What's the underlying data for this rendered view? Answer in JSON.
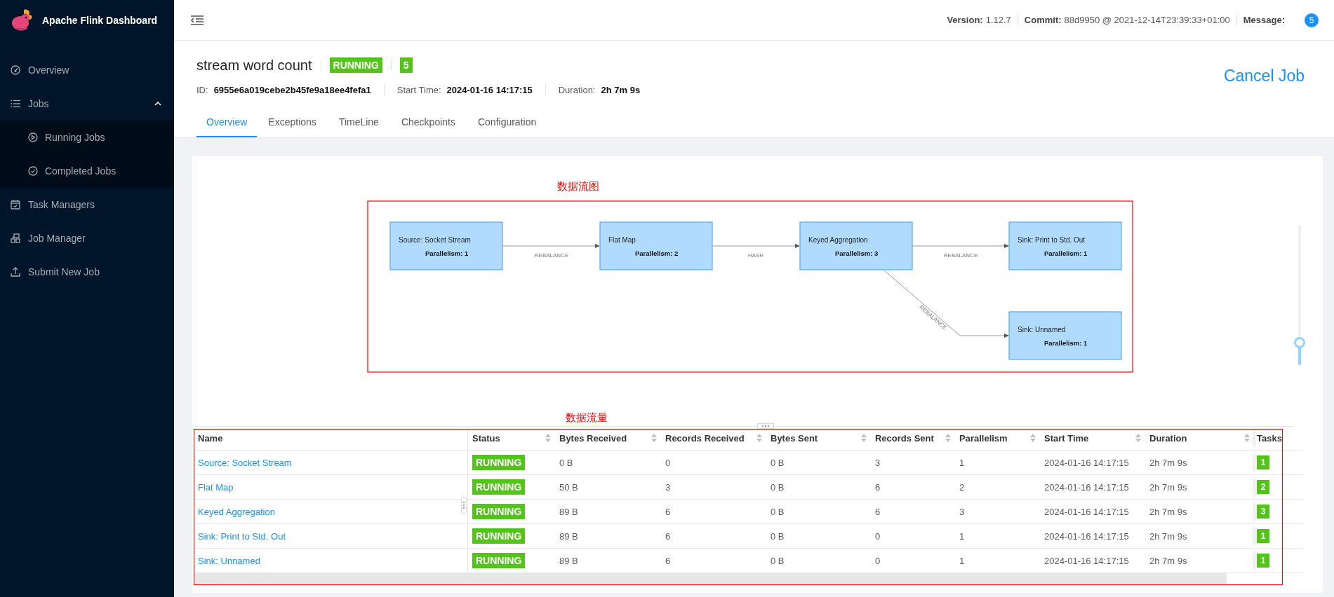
{
  "app": {
    "title": "Apache Flink Dashboard"
  },
  "sidebar": {
    "items": [
      {
        "label": "Overview"
      },
      {
        "label": "Jobs",
        "expanded": true,
        "children": [
          {
            "label": "Running Jobs"
          },
          {
            "label": "Completed Jobs"
          }
        ]
      },
      {
        "label": "Task Managers"
      },
      {
        "label": "Job Manager"
      },
      {
        "label": "Submit New Job"
      }
    ]
  },
  "header_info": [
    {
      "label": "Version:",
      "value": "1.12.7"
    },
    {
      "label": "Commit:",
      "value": "88d9950 @ 2021-12-14T23:39:33+01:00"
    },
    {
      "label": "Message:",
      "badge": "5"
    }
  ],
  "job": {
    "name": "stream word count",
    "status": "RUNNING",
    "task_count": "5",
    "meta": [
      {
        "label": "ID:",
        "value": "6955e6a019cebe2b45fe9a18ee4fefa1"
      },
      {
        "label": "Start Time:",
        "value": "2024-01-16 14:17:15"
      },
      {
        "label": "Duration:",
        "value": "2h 7m 9s"
      }
    ],
    "cancel_button": "Cancel Job"
  },
  "tabs": [
    {
      "label": "Overview",
      "selected": true
    },
    {
      "label": "Exceptions",
      "selected": false
    },
    {
      "label": "TimeLine",
      "selected": false
    },
    {
      "label": "Checkpoints",
      "selected": false
    },
    {
      "label": "Configuration",
      "selected": false
    }
  ],
  "graph": {
    "annotation": "数据流图",
    "nodes": [
      {
        "name": "Source: Socket Stream",
        "parallelism": "Parallelism: 1"
      },
      {
        "name": "Flat Map",
        "parallelism": "Parallelism: 2"
      },
      {
        "name": "Keyed Aggregation",
        "parallelism": "Parallelism: 3"
      },
      {
        "name": "Sink: Print to Std. Out",
        "parallelism": "Parallelism: 1"
      },
      {
        "name": "Sink: Unnamed",
        "parallelism": "Parallelism: 1"
      }
    ],
    "edges": [
      {
        "label": "REBALANCE"
      },
      {
        "label": "HASH"
      },
      {
        "label": "REBALANCE"
      },
      {
        "label": "REBALANCE"
      }
    ],
    "zoom_slider": {
      "level": 0.15
    }
  },
  "table": {
    "annotation": "数据流量",
    "columns": [
      {
        "label": "Name",
        "sortable": false
      },
      {
        "label": "Status",
        "sortable": true
      },
      {
        "label": "Bytes Received",
        "sortable": true
      },
      {
        "label": "Records Received",
        "sortable": true
      },
      {
        "label": "Bytes Sent",
        "sortable": true
      },
      {
        "label": "Records Sent",
        "sortable": true
      },
      {
        "label": "Parallelism",
        "sortable": true
      },
      {
        "label": "Start Time",
        "sortable": true
      },
      {
        "label": "Duration",
        "sortable": true
      },
      {
        "label": "Tasks",
        "sortable": false
      }
    ],
    "rows": [
      {
        "name": "Source: Socket Stream",
        "status": "RUNNING",
        "bytes_received": "0 B",
        "records_received": "0",
        "bytes_sent": "0 B",
        "records_sent": "3",
        "parallelism": "1",
        "start_time": "2024-01-16 14:17:15",
        "duration": "2h 7m 9s",
        "tasks": "1"
      },
      {
        "name": "Flat Map",
        "status": "RUNNING",
        "bytes_received": "50 B",
        "records_received": "3",
        "bytes_sent": "0 B",
        "records_sent": "6",
        "parallelism": "2",
        "start_time": "2024-01-16 14:17:15",
        "duration": "2h 7m 9s",
        "tasks": "2"
      },
      {
        "name": "Keyed Aggregation",
        "status": "RUNNING",
        "bytes_received": "89 B",
        "records_received": "6",
        "bytes_sent": "0 B",
        "records_sent": "6",
        "parallelism": "3",
        "start_time": "2024-01-16 14:17:15",
        "duration": "2h 7m 9s",
        "tasks": "3"
      },
      {
        "name": "Sink: Print to Std. Out",
        "status": "RUNNING",
        "bytes_received": "89 B",
        "records_received": "6",
        "bytes_sent": "0 B",
        "records_sent": "0",
        "parallelism": "1",
        "start_time": "2024-01-16 14:17:15",
        "duration": "2h 7m 9s",
        "tasks": "1"
      },
      {
        "name": "Sink: Unnamed",
        "status": "RUNNING",
        "bytes_received": "89 B",
        "records_received": "6",
        "bytes_sent": "0 B",
        "records_sent": "0",
        "parallelism": "1",
        "start_time": "2024-01-16 14:17:15",
        "duration": "2h 7m 9s",
        "tasks": "1"
      }
    ]
  }
}
